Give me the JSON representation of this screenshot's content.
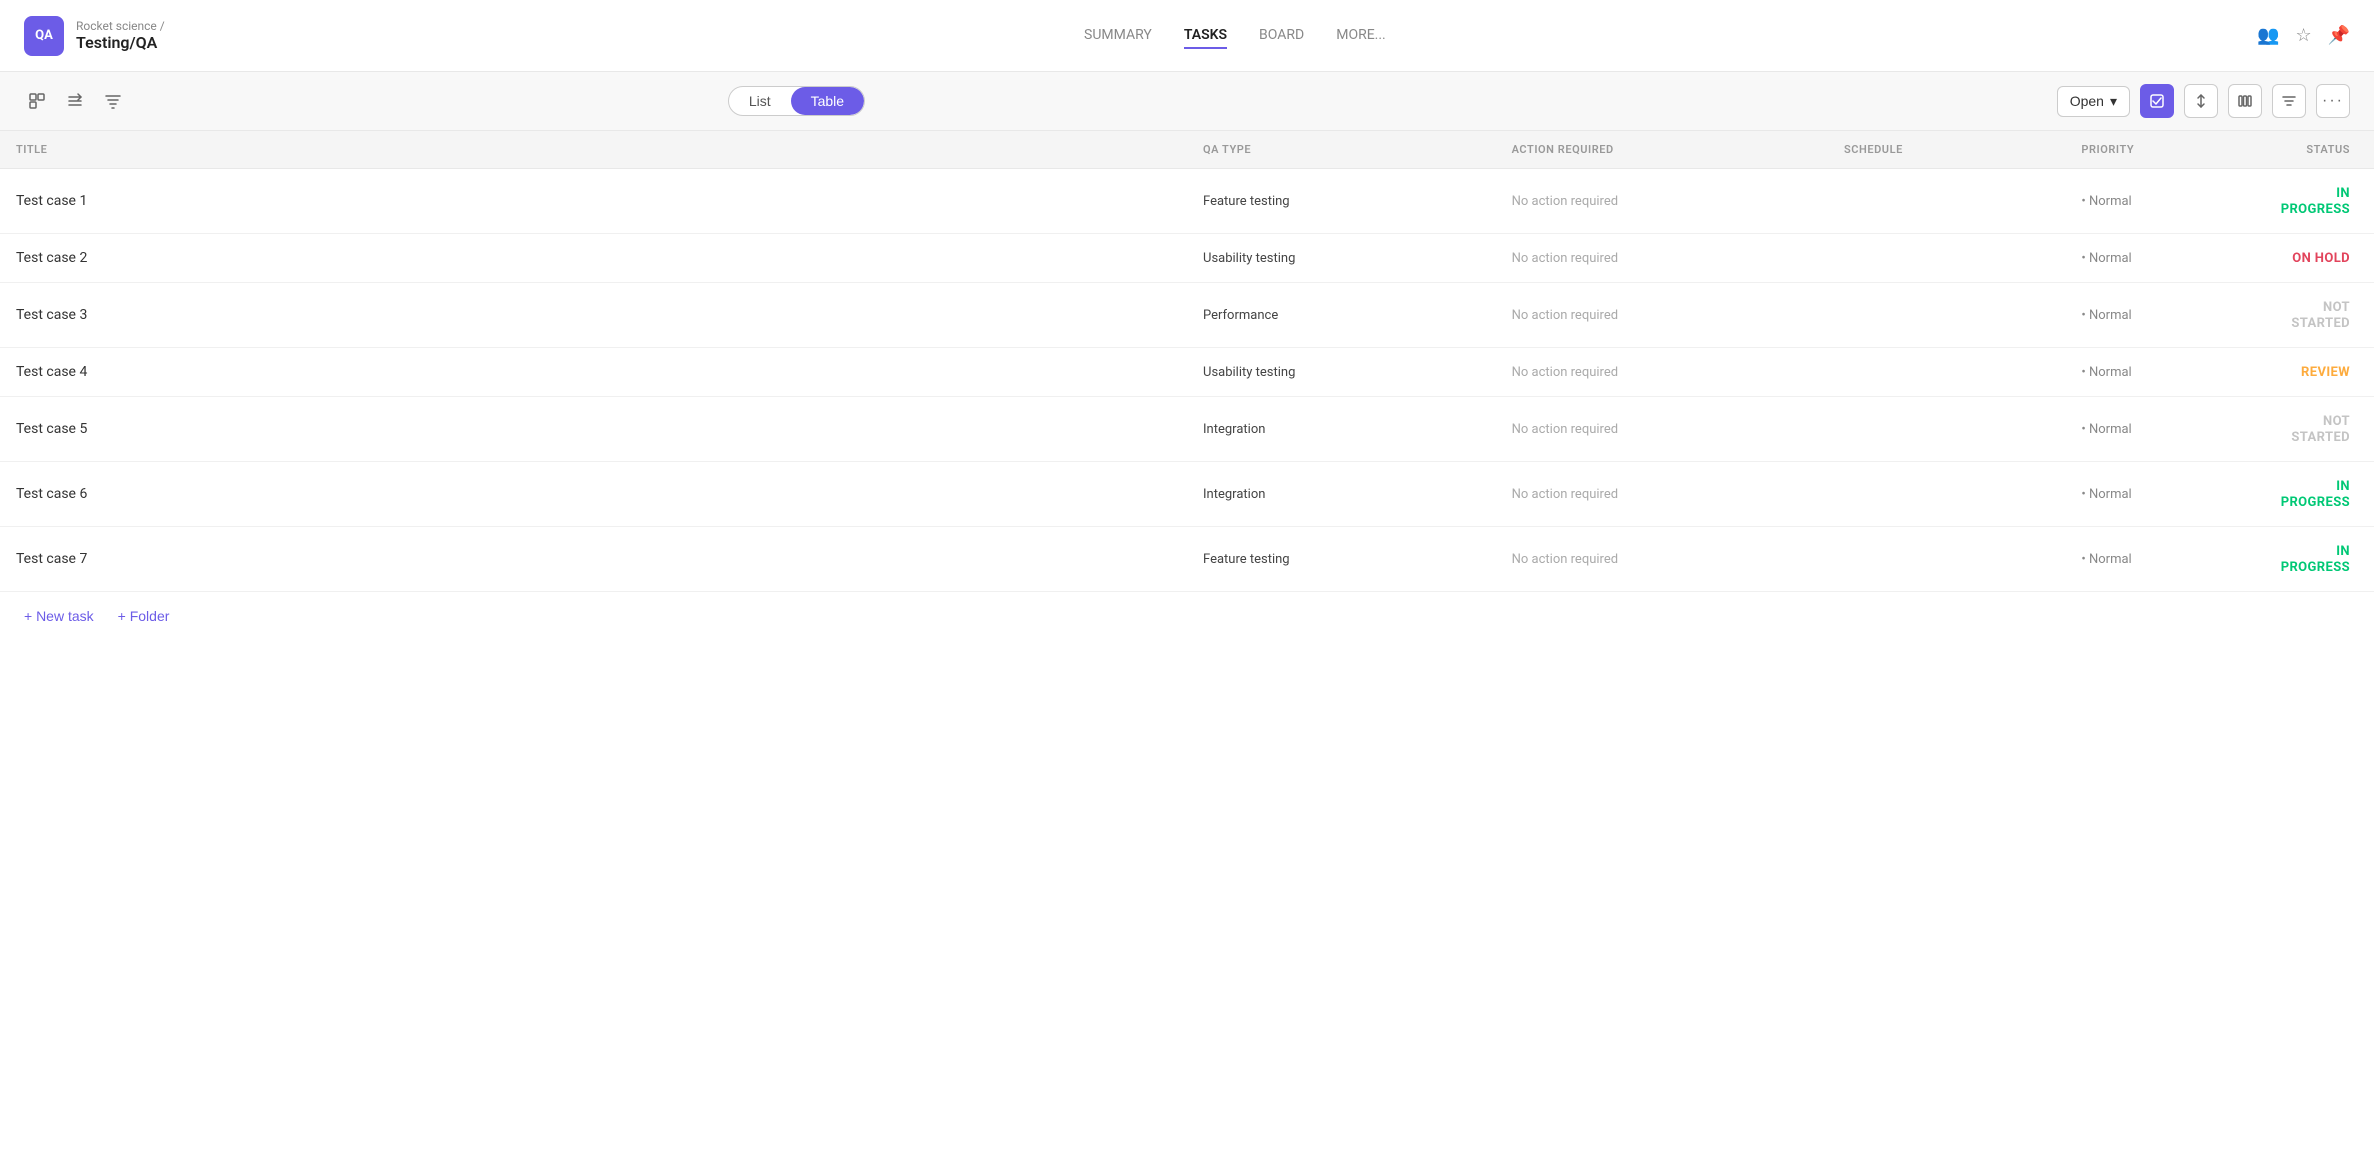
{
  "header": {
    "logo_text": "QA",
    "breadcrumb_parent": "Rocket science /",
    "breadcrumb_current": "Testing/QA",
    "nav_tabs": [
      {
        "id": "summary",
        "label": "SUMMARY",
        "active": false
      },
      {
        "id": "tasks",
        "label": "TASKS",
        "active": true
      },
      {
        "id": "board",
        "label": "BOARD",
        "active": false
      },
      {
        "id": "more",
        "label": "MORE...",
        "active": false
      }
    ],
    "right_icons": {
      "people": "👥",
      "star": "☆",
      "pin": "📌"
    }
  },
  "toolbar": {
    "left_icons": [
      {
        "id": "expand",
        "symbol": "⊞"
      },
      {
        "id": "group",
        "symbol": "⇅"
      },
      {
        "id": "filter-sort",
        "symbol": "⧉"
      }
    ],
    "view_toggle": {
      "list_label": "List",
      "table_label": "Table",
      "active": "Table"
    },
    "right": {
      "open_label": "Open",
      "icons": [
        {
          "id": "check",
          "symbol": "☑",
          "active": true
        },
        {
          "id": "sort",
          "symbol": "↑↓"
        },
        {
          "id": "columns",
          "symbol": "⦿"
        },
        {
          "id": "filter",
          "symbol": "⊟"
        },
        {
          "id": "more",
          "symbol": "•••"
        }
      ]
    }
  },
  "table": {
    "columns": [
      {
        "id": "title",
        "label": "TITLE"
      },
      {
        "id": "qa_type",
        "label": "QA TYPE"
      },
      {
        "id": "action_required",
        "label": "ACTION REQUIRED"
      },
      {
        "id": "schedule",
        "label": "SCHEDULE"
      },
      {
        "id": "priority",
        "label": "PRIORITY"
      },
      {
        "id": "status",
        "label": "STATUS"
      }
    ],
    "rows": [
      {
        "id": 1,
        "title": "Test case 1",
        "qa_type": "Feature testing",
        "action_required": "No action required",
        "schedule": "",
        "priority": "Normal",
        "status": "IN PROGRESS",
        "status_class": "status-in-progress"
      },
      {
        "id": 2,
        "title": "Test case 2",
        "qa_type": "Usability testing",
        "action_required": "No action required",
        "schedule": "",
        "priority": "Normal",
        "status": "ON HOLD",
        "status_class": "status-on-hold"
      },
      {
        "id": 3,
        "title": "Test case 3",
        "qa_type": "Performance",
        "action_required": "No action required",
        "schedule": "",
        "priority": "Normal",
        "status": "NOT STARTED",
        "status_class": "status-not-started"
      },
      {
        "id": 4,
        "title": "Test case 4",
        "qa_type": "Usability testing",
        "action_required": "No action required",
        "schedule": "",
        "priority": "Normal",
        "status": "REVIEW",
        "status_class": "status-review"
      },
      {
        "id": 5,
        "title": "Test case 5",
        "qa_type": "Integration",
        "action_required": "No action required",
        "schedule": "",
        "priority": "Normal",
        "status": "NOT STARTED",
        "status_class": "status-not-started"
      },
      {
        "id": 6,
        "title": "Test case 6",
        "qa_type": "Integration",
        "action_required": "No action required",
        "schedule": "",
        "priority": "Normal",
        "status": "IN PROGRESS",
        "status_class": "status-in-progress"
      },
      {
        "id": 7,
        "title": "Test case 7",
        "qa_type": "Feature testing",
        "action_required": "No action required",
        "schedule": "",
        "priority": "Normal",
        "status": "IN PROGRESS",
        "status_class": "status-in-progress"
      }
    ]
  },
  "footer": {
    "new_task_label": "+ New task",
    "folder_label": "+ Folder"
  }
}
